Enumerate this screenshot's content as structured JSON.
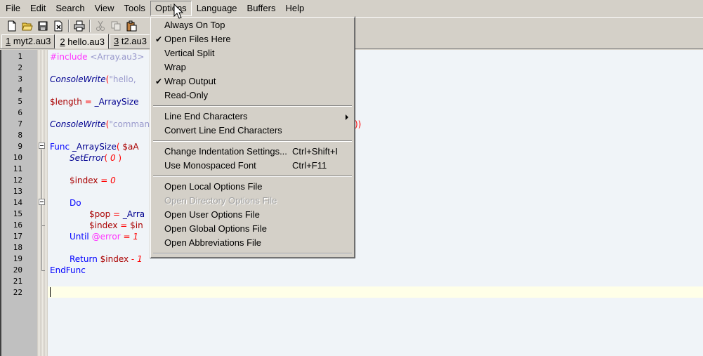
{
  "menubar": {
    "items": [
      "File",
      "Edit",
      "Search",
      "View",
      "Tools",
      "Options",
      "Language",
      "Buffers",
      "Help"
    ],
    "active": "Options"
  },
  "toolbar": {
    "icons": [
      "new-file-icon",
      "open-file-icon",
      "save-icon",
      "close-file-icon",
      "print-icon",
      "cut-icon",
      "copy-icon",
      "paste-icon"
    ]
  },
  "tabs": [
    {
      "num": "1",
      "label": "myt2.au3"
    },
    {
      "num": "2",
      "label": "hello.au3"
    },
    {
      "num": "3",
      "label": "t2.au3"
    }
  ],
  "editor": {
    "line_numbers": [
      "1",
      "2",
      "3",
      "4",
      "5",
      "6",
      "7",
      "8",
      "9",
      "10",
      "11",
      "12",
      "13",
      "14",
      "15",
      "16",
      "17",
      "18",
      "19",
      "20",
      "21",
      "22"
    ],
    "code": {
      "l1_pre": "#include",
      "l1_str": "<Array.au3>",
      "l3_fn": "ConsoleWrite",
      "l3_paren": "(",
      "l3_str": "\"hello,",
      "l5_var": "$length",
      "l5_op": " = ",
      "l5_fn": "_ArraySize",
      "l7_fn": "ConsoleWrite",
      "l7_paren": "(",
      "l7_str": "\"comman",
      "l7_tail": "))",
      "l9_kw": "Func",
      "l9_def": " _ArraySize",
      "l9_paren": "( ",
      "l9_var": "$aA",
      "l10_fn": "SetError",
      "l10_paren": "( ",
      "l10_num": "0",
      "l10_close": " )",
      "l12_var": "$index",
      "l12_op": " = ",
      "l12_num": "0",
      "l14_kw": "Do",
      "l15_var": "$pop",
      "l15_op": " = ",
      "l15_fn": "_Arra",
      "l16_var": "$index",
      "l16_op": " = ",
      "l16_var2": "$in",
      "l17_kw": "Until",
      "l17_macro": " @error",
      "l17_op": " = ",
      "l17_num": "1",
      "l19_kw": "Return",
      "l19_var": " $index",
      "l19_op": " - ",
      "l19_num": "1",
      "l20_kw": "EndFunc"
    }
  },
  "options_menu": {
    "always_on_top": "Always On Top",
    "open_files_here": "Open Files Here",
    "vertical_split": "Vertical Split",
    "wrap": "Wrap",
    "wrap_output": "Wrap Output",
    "read_only": "Read-Only",
    "line_end_chars": "Line End Characters",
    "convert_line_end": "Convert Line End Characters",
    "change_indent": "Change Indentation Settings...",
    "change_indent_sc": "Ctrl+Shift+I",
    "mono_font": "Use Monospaced Font",
    "mono_font_sc": "Ctrl+F11",
    "open_local": "Open Local Options File",
    "open_directory": "Open Directory Options File",
    "open_user": "Open User Options File",
    "open_global": "Open Global Options File",
    "open_abbrev": "Open Abbreviations File",
    "check": "✔"
  }
}
